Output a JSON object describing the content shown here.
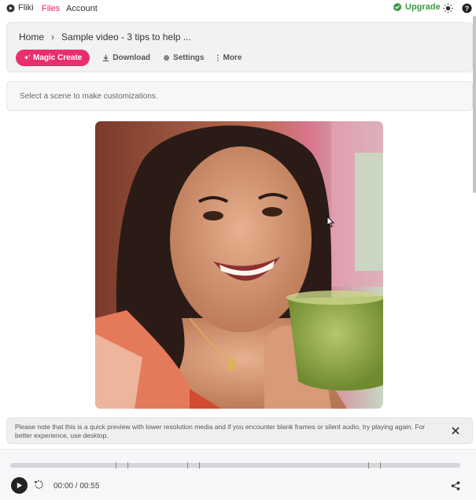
{
  "nav": {
    "brand": "Fliki",
    "files": "Files",
    "account": "Account",
    "upgrade": "Upgrade",
    "icons": [
      "fliki-logo-icon",
      "verified-badge-icon",
      "theme-toggle-icon",
      "help-icon"
    ]
  },
  "breadcrumb": {
    "home": "Home",
    "separator": "›",
    "current": "Sample video - 3 tips to help ..."
  },
  "actions": {
    "magic_create": "Magic Create",
    "download": "Download",
    "settings": "Settings",
    "more": "More"
  },
  "scene": {
    "hint": "Select a scene to make customizations."
  },
  "notice": {
    "text": "Please note that this is a quick preview with lower resolution media and if you encounter blank frames or silent audio, try playing again. For better experience, use desktop."
  },
  "player": {
    "time": "00:00 / 00:55",
    "progress_fraction": 0
  },
  "colors": {
    "accent": "#ea2d6f",
    "upgrade_green": "#3b9b47",
    "files_pink": "#e91e63"
  }
}
